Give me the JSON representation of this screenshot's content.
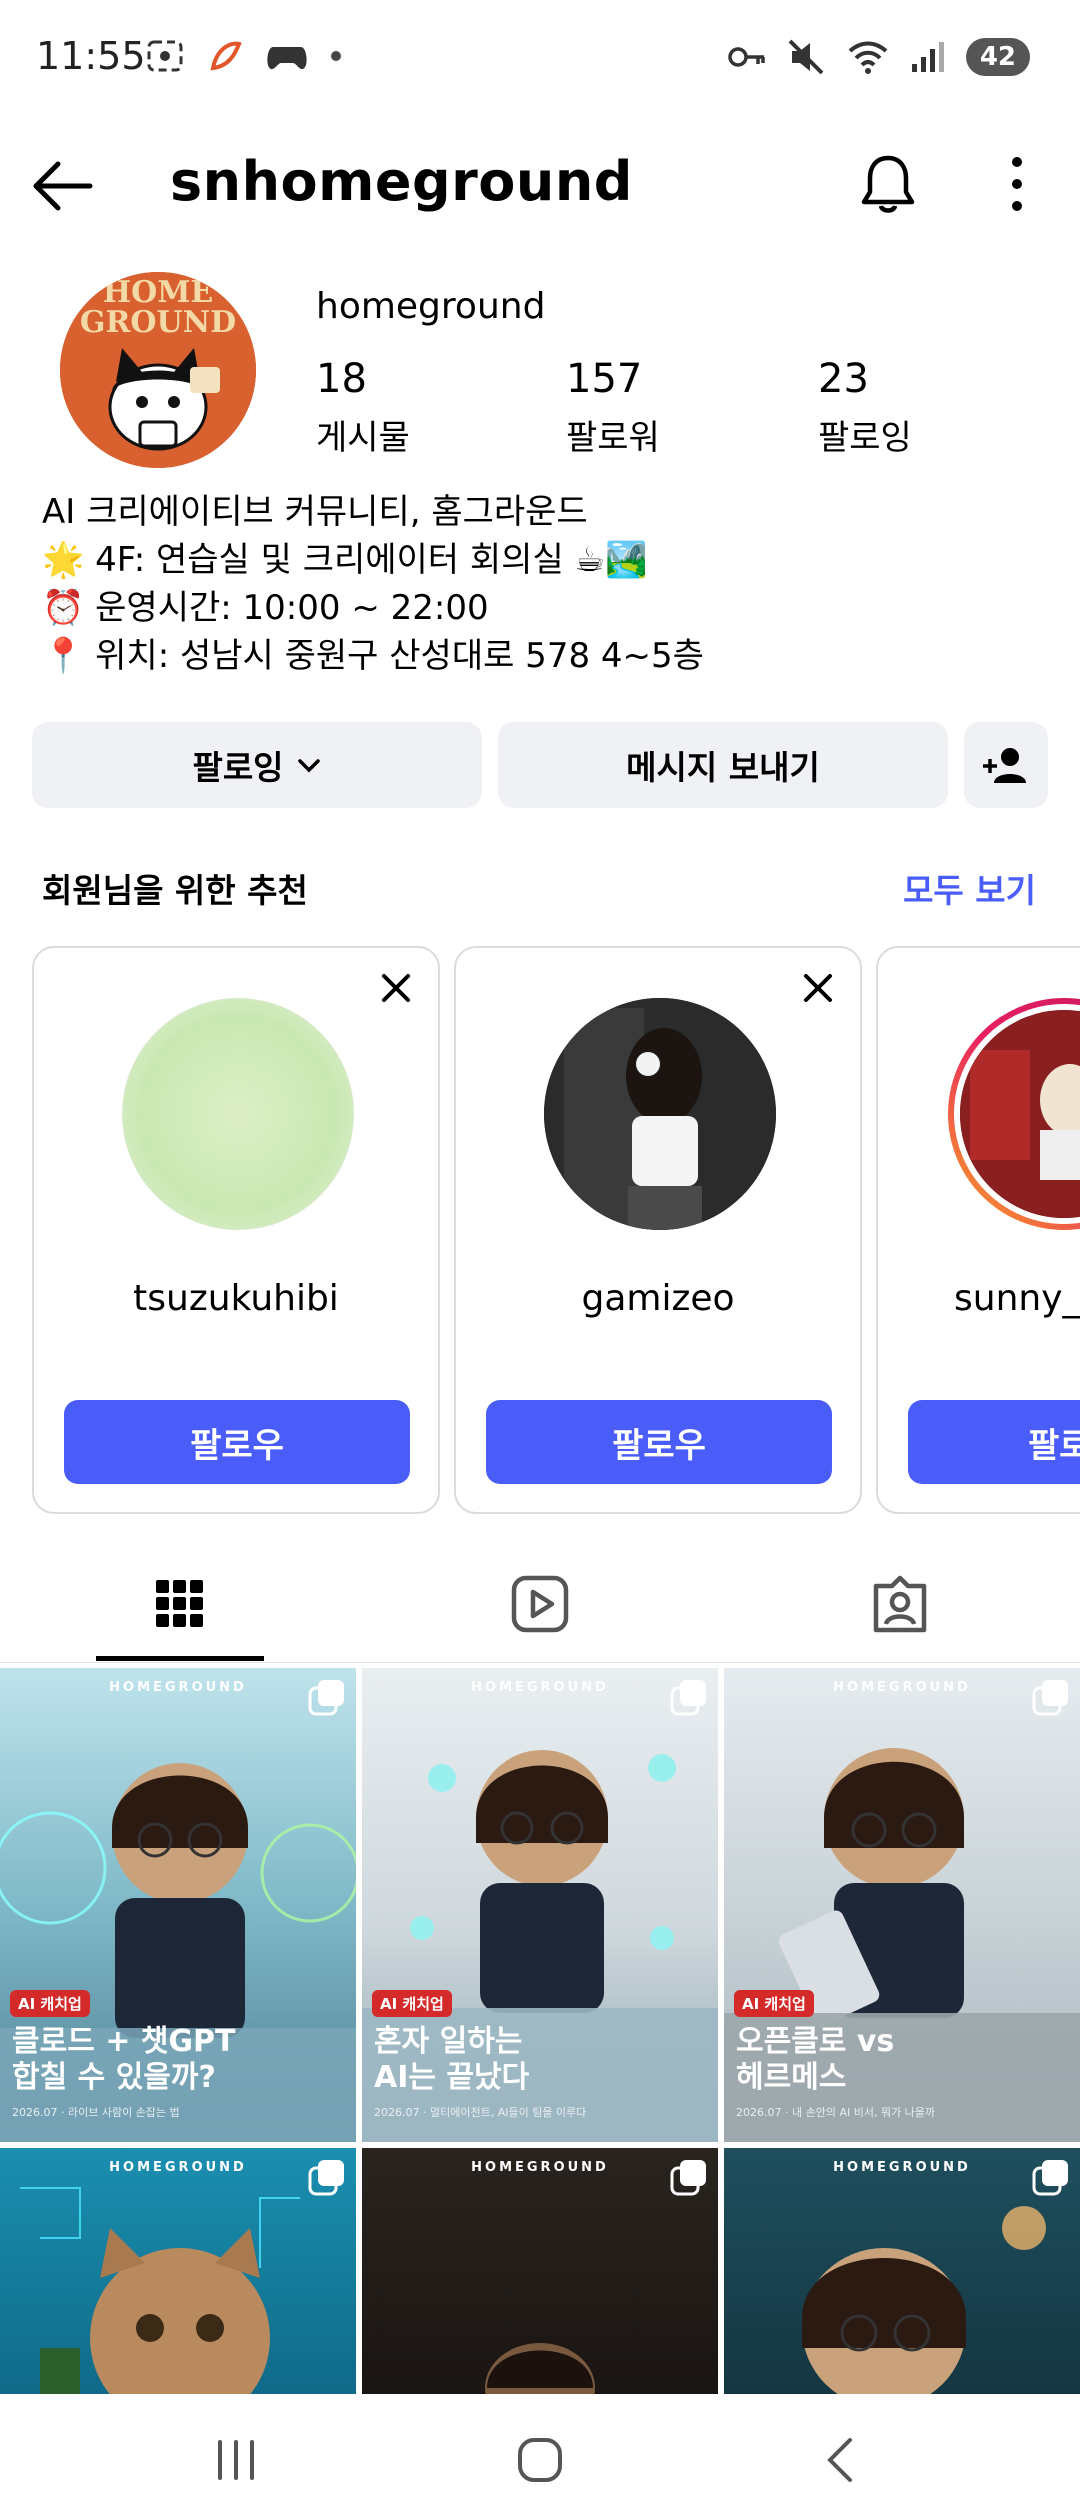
{
  "status_bar": {
    "time": "11:55",
    "battery": "42",
    "icons_left": [
      "screenshot-icon",
      "brand-app-icon",
      "game-controller-icon",
      "dot-icon"
    ],
    "icons_right": [
      "key-icon",
      "mute-icon",
      "wifi-icon",
      "signal-icon"
    ]
  },
  "header": {
    "username": "snhomeground",
    "back_icon": "arrow-left-icon",
    "notification_icon": "bell-icon",
    "more_icon": "more-vertical-icon"
  },
  "profile": {
    "avatar_text": "GROUND",
    "avatar_top": "HOME",
    "display_name": "homeground",
    "stats": [
      {
        "value": "18",
        "label": "게시물"
      },
      {
        "value": "157",
        "label": "팔로워"
      },
      {
        "value": "23",
        "label": "팔로잉"
      }
    ],
    "bio": [
      "AI 크리에이티브 커뮤니티, 홈그라운드",
      "🌟 4F: 연습실 및 크리에이터 회의실 ☕🏞️",
      "⏰ 운영시간: 10:00 ~ 22:00",
      "📍 위치: 성남시 중원구 산성대로 578 4~5층"
    ]
  },
  "actions": {
    "following_label": "팔로잉",
    "message_label": "메시지 보내기",
    "add_user_icon": "add-user-icon"
  },
  "suggestions": {
    "title": "회원님을 위한 추천",
    "see_all": "모두 보기",
    "cards": [
      {
        "name": "tsuzukuhibi",
        "follow": "팔로우"
      },
      {
        "name": "gamizeo",
        "follow": "팔로우"
      },
      {
        "name": "sunny_",
        "follow": "팔로"
      }
    ]
  },
  "tabs": [
    {
      "icon": "grid-icon",
      "active": true
    },
    {
      "icon": "reels-icon",
      "active": false
    },
    {
      "icon": "tagged-icon",
      "active": false
    }
  ],
  "grid": {
    "brand": "HOMEGROUND",
    "posts": [
      {
        "tag": "AI 캐치업",
        "line1": "클로드 + 챗GPT",
        "line2": "합칠 수 있을까?",
        "sub": "2026.07 · 라이브 사람이 손잡는 법"
      },
      {
        "tag": "AI 캐치업",
        "line1": "혼자 일하는",
        "line2": "AI는 끝났다",
        "sub": "2026.07 · 멀티에이전트, AI들이 팀을 이루다"
      },
      {
        "tag": "AI 캐치업",
        "line1": "오픈클로 vs",
        "line2": "헤르메스",
        "sub": "2026.07 · 내 손안의 AI 비서, 뭐가 나을까"
      },
      {
        "tag": "",
        "line1": "",
        "line2": "",
        "sub": ""
      },
      {
        "tag": "",
        "line1": "",
        "line2": "",
        "sub": ""
      },
      {
        "tag": "",
        "line1": "",
        "line2": "",
        "sub": ""
      }
    ]
  },
  "nav": {
    "recents_icon": "recents-icon",
    "home_icon": "home-icon",
    "back_icon": "back-chevron-icon"
  },
  "colors": {
    "accent": "#4a5df9",
    "button_bg": "#eff1f4",
    "avatar_bg": "#d8612f"
  }
}
